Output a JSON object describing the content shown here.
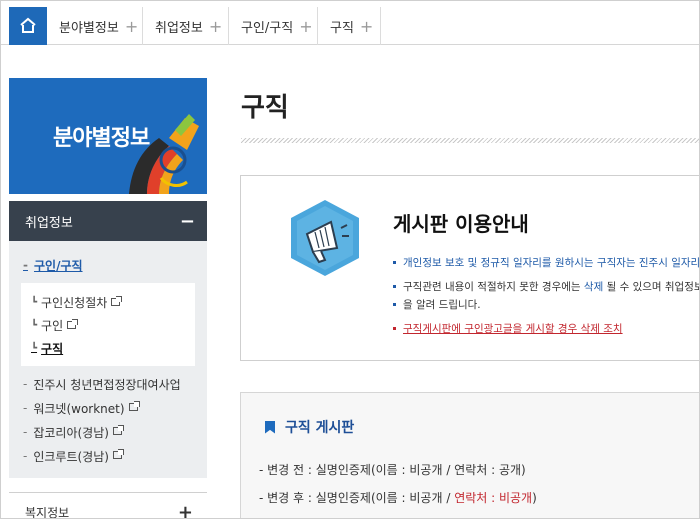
{
  "tabs": [
    {
      "label": "분야별정보"
    },
    {
      "label": "취업정보"
    },
    {
      "label": "구인/구직"
    },
    {
      "label": "구직"
    }
  ],
  "banner": {
    "title": "분야별정보"
  },
  "sidebar": {
    "section_title": "취업정보",
    "active_group": "구인/구직",
    "sub_items": [
      "구인신청절차",
      "구인",
      "구직"
    ],
    "items": [
      "진주시 청년면접정장대여사업",
      "워크넷(worknet)",
      "잡코리아(경남)",
      "인크루트(경남)"
    ],
    "footer_title": "복지정보"
  },
  "page": {
    "title": "구직"
  },
  "guide": {
    "title": "게시판 이용안내",
    "bullet1": "개인정보 보호 및 정규직 일자리를 원하시는 구직자는 진주시 일자리",
    "bullet2_pre": "구직관련 내용이 적절하지 못한 경우에는 ",
    "bullet2_hl": "삭제",
    "bullet2_post": " 될 수 있으며 취업정보",
    "bullet2_line2": "을 알려 드립니다.",
    "bullet3": "구직게시판에 구인광고글을 게시할 경우 삭제 조치"
  },
  "board": {
    "title": "구직 게시판",
    "line1": "- 변경 전 : 실명인증제(이름 : 비공개 / 연락처 : 공개)",
    "line2_pre": "- 변경 후 : 실명인증제(이름 : 비공개 / ",
    "line2_hl": "연락처 : 비공개",
    "line2_post": ")"
  },
  "colors": {
    "primary": "#1e6bbd",
    "dark_header": "#37414d",
    "accent_red": "#c2262e"
  }
}
